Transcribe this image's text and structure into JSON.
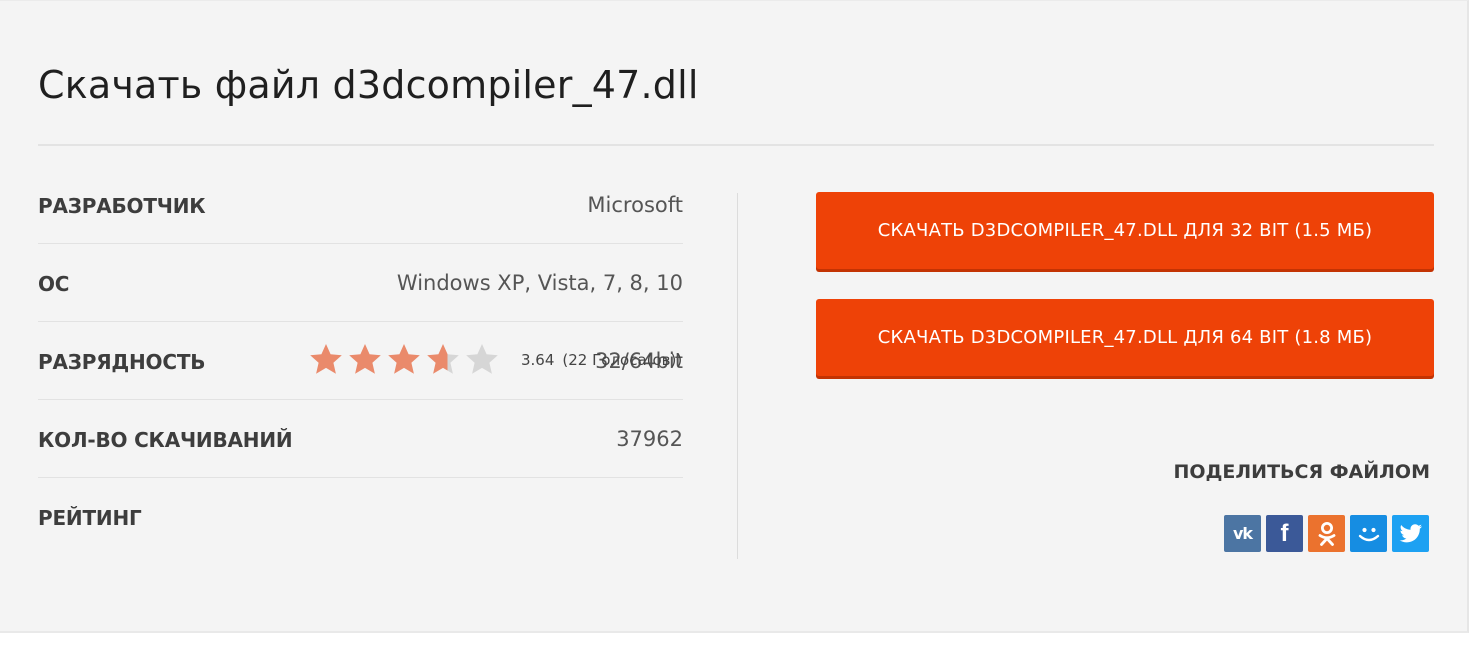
{
  "title": "Скачать файл d3dcompiler_47.dll",
  "info_rows": [
    {
      "label": "РАЗРАБОТЧИК",
      "value": "Microsoft"
    },
    {
      "label": "ОС",
      "value": "Windows XP, Vista, 7, 8, 10"
    },
    {
      "label": "РАЗРЯДНОСТЬ",
      "value": "32/64bit"
    },
    {
      "label": "КОЛ-ВО СКАЧИВАНИЙ",
      "value": "37962"
    },
    {
      "label": "РЕЙТИНГ",
      "value": ""
    }
  ],
  "rating": {
    "score": "3.64",
    "votes": "(22 Голоса(ов))",
    "stars_max": 5,
    "stars_value": 3.64,
    "filled_color": "#ea8a6b",
    "empty_color": "#d6d6d6"
  },
  "downloads": {
    "btn_32": "СКАЧАТЬ D3DCOMPILER_47.DLL ДЛЯ 32 BIT (1.5 МБ)",
    "btn_64": "СКАЧАТЬ D3DCOMPILER_47.DLL ДЛЯ 64 BIT (1.8 МБ)",
    "button_color": "#ee4207"
  },
  "share": {
    "title": "ПОДЕЛИТЬСЯ ФАЙЛОМ",
    "networks": [
      {
        "name": "vk-icon",
        "color": "#4c75a3"
      },
      {
        "name": "facebook-icon",
        "color": "#3b5998"
      },
      {
        "name": "odnoklassniki-icon",
        "color": "#eb722e"
      },
      {
        "name": "moimir-icon",
        "color": "#168de2"
      },
      {
        "name": "twitter-icon",
        "color": "#1da1f2"
      }
    ]
  }
}
